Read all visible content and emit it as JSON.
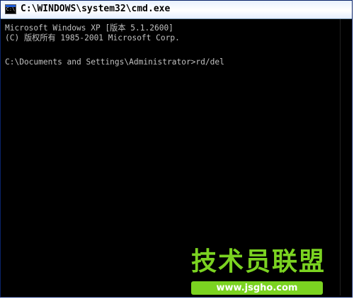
{
  "window": {
    "title": "C:\\WINDOWS\\system32\\cmd.exe",
    "icon": "cmd-icon"
  },
  "console": {
    "lines": [
      "Microsoft Windows XP [版本 5.1.2600]",
      "(C) 版权所有 1985-2001 Microsoft Corp.",
      "",
      "C:\\Documents and Settings\\Administrator>rd/del"
    ]
  },
  "watermark": {
    "title": "技术员联盟",
    "url": "www.jsgho.com"
  },
  "colors": {
    "console_text": "#c0c0c0",
    "console_bg": "#000000",
    "watermark_green": "#7bd321"
  }
}
